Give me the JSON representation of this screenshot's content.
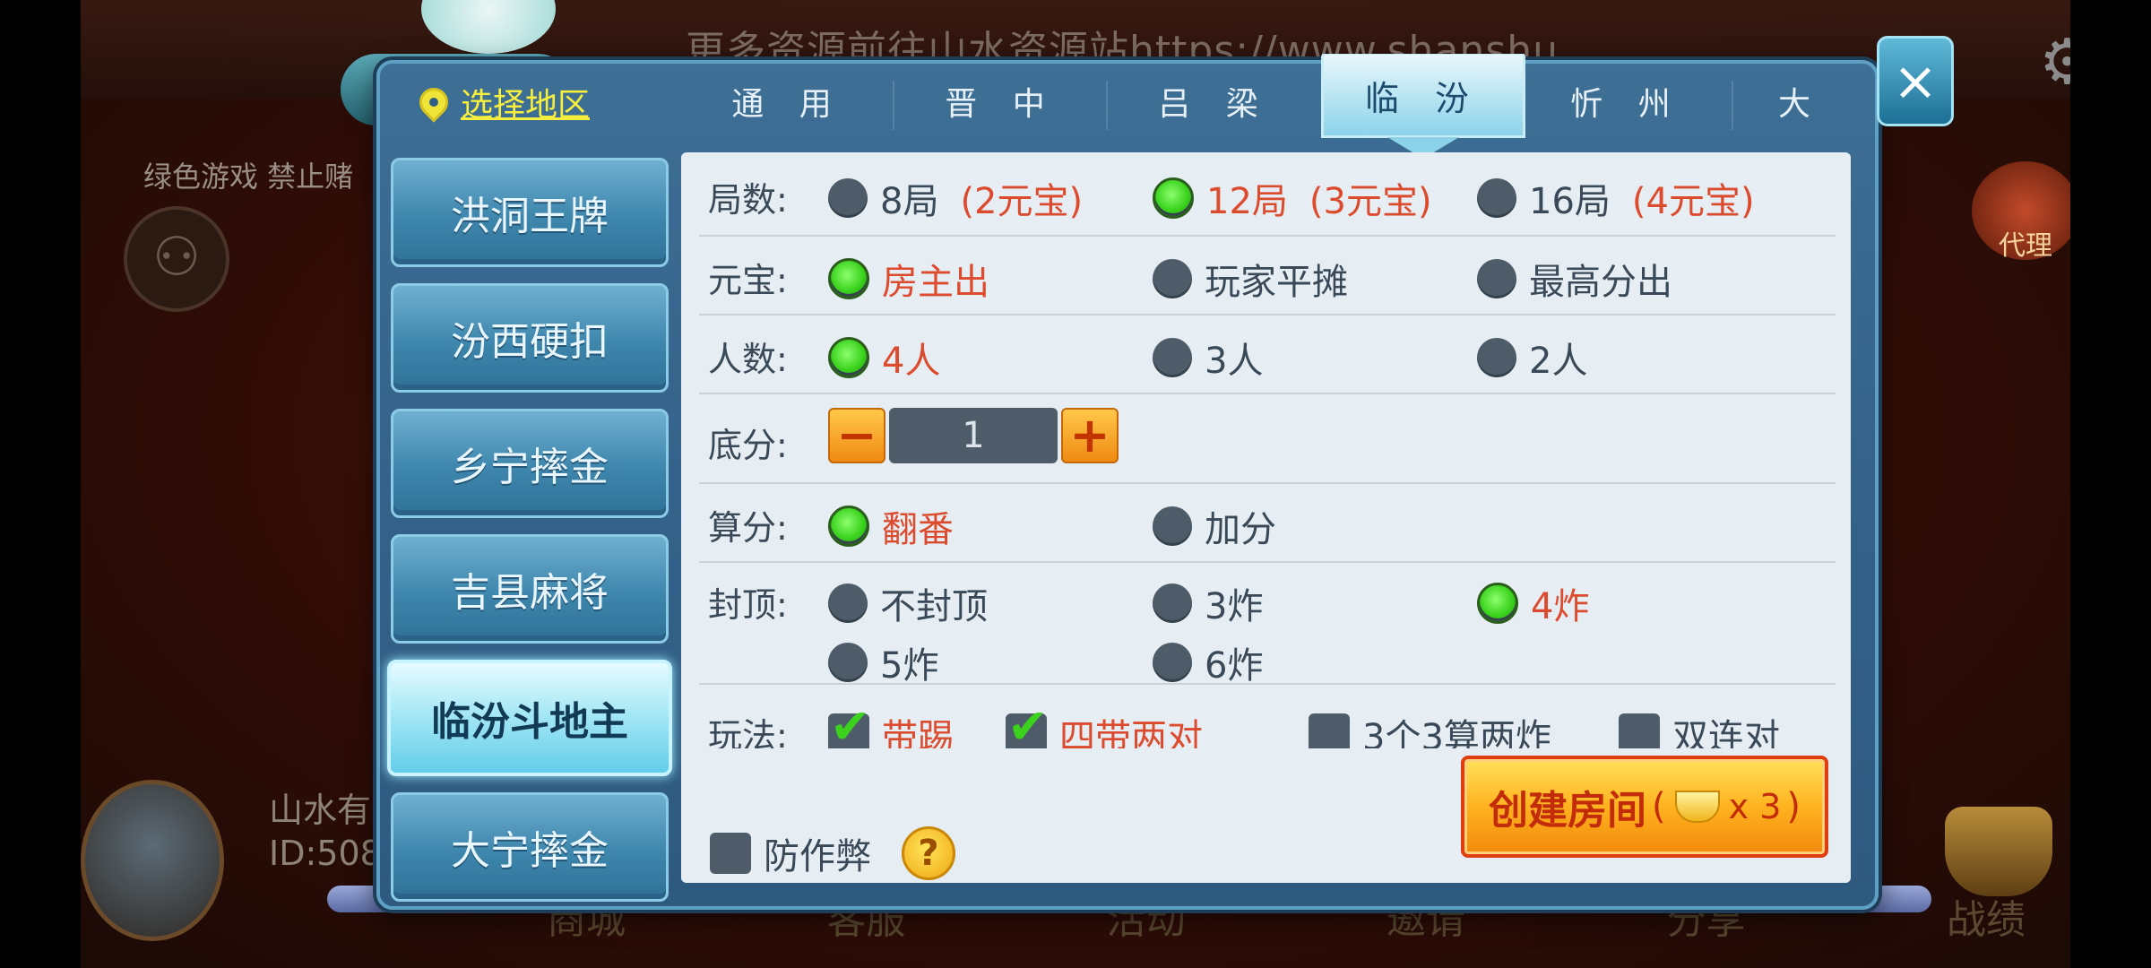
{
  "background": {
    "watermark_url": "更多资源前往山水资源站https://www.shanshu",
    "green_game_notice": "绿色游戏 禁止赌",
    "user_name": "山水有",
    "user_id": "ID:508",
    "bottom_nav": [
      "商城",
      "客服",
      "活动",
      "邀请",
      "分享",
      "战绩"
    ],
    "agent_label": "代理"
  },
  "header": {
    "region_label": "选择地区",
    "tabs": [
      {
        "label": "通 用"
      },
      {
        "label": "晋 中"
      },
      {
        "label": "吕 梁"
      },
      {
        "label": "临 汾",
        "active": true
      },
      {
        "label": "忻 州"
      },
      {
        "label": "大"
      }
    ],
    "close_symbol": "×"
  },
  "games": [
    {
      "label": "洪洞王牌"
    },
    {
      "label": "汾西硬扣"
    },
    {
      "label": "乡宁摔金"
    },
    {
      "label": "吉县麻将"
    },
    {
      "label": "临汾斗地主",
      "selected": true
    },
    {
      "label": "大宁摔金"
    }
  ],
  "settings": {
    "rounds": {
      "label": "局数:",
      "options": [
        {
          "text": "8局",
          "price": "(2元宝)",
          "selected": false
        },
        {
          "text": "12局",
          "price": "(3元宝)",
          "selected": true
        },
        {
          "text": "16局",
          "price": "(4元宝)",
          "selected": false
        }
      ]
    },
    "payment": {
      "label": "元宝:",
      "options": [
        {
          "text": "房主出",
          "selected": true
        },
        {
          "text": "玩家平摊",
          "selected": false
        },
        {
          "text": "最高分出",
          "selected": false
        }
      ]
    },
    "players": {
      "label": "人数:",
      "options": [
        {
          "text": "4人",
          "selected": true
        },
        {
          "text": "3人",
          "selected": false
        },
        {
          "text": "2人",
          "selected": false
        }
      ]
    },
    "base_score": {
      "label": "底分:",
      "value": "1",
      "minus": "−",
      "plus": "+"
    },
    "scoring": {
      "label": "算分:",
      "options": [
        {
          "text": "翻番",
          "selected": true
        },
        {
          "text": "加分",
          "selected": false
        }
      ]
    },
    "cap": {
      "label": "封顶:",
      "options": [
        {
          "text": "不封顶",
          "selected": false
        },
        {
          "text": "3炸",
          "selected": false
        },
        {
          "text": "4炸",
          "selected": true
        },
        {
          "text": "5炸",
          "selected": false
        },
        {
          "text": "6炸",
          "selected": false
        }
      ]
    },
    "rules": {
      "label": "玩法:",
      "options": [
        {
          "text": "带踢",
          "checked": true
        },
        {
          "text": "四带两对",
          "checked": true
        },
        {
          "text": "3个3算两炸",
          "checked": false
        },
        {
          "text": "双连对",
          "checked": false
        }
      ]
    },
    "anti_cheat": {
      "label": "防作弊",
      "checked": false,
      "help": "?"
    }
  },
  "create_button": {
    "label": "创建房间",
    "open_paren": "(",
    "cost": "x 3",
    "close_paren": ")"
  }
}
